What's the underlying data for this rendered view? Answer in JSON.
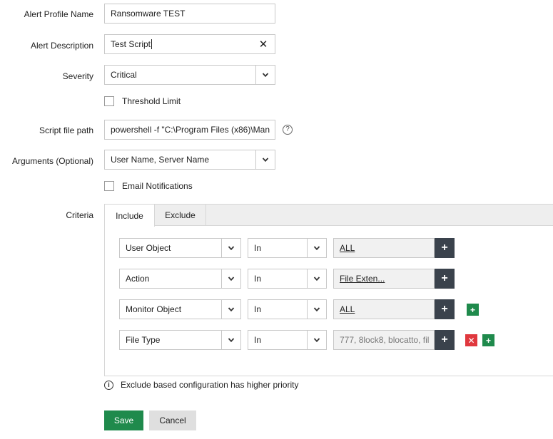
{
  "form": {
    "alert_profile_name": {
      "label": "Alert Profile Name",
      "value": "Ransomware TEST"
    },
    "alert_description": {
      "label": "Alert Description",
      "value": "Test Script"
    },
    "severity": {
      "label": "Severity",
      "value": "Critical"
    },
    "threshold_limit": {
      "label": "Threshold Limit",
      "checked": false
    },
    "script_file_path": {
      "label": "Script file path",
      "value": "powershell -f \"C:\\Program Files (x86)\\Man"
    },
    "arguments": {
      "label": "Arguments (Optional)",
      "value": "User Name, Server Name"
    },
    "email_notifications": {
      "label": "Email Notifications",
      "checked": false
    }
  },
  "criteria": {
    "label": "Criteria",
    "tabs": [
      {
        "label": "Include",
        "active": true
      },
      {
        "label": "Exclude",
        "active": false
      }
    ],
    "rows": [
      {
        "field": "User Object",
        "operator": "In",
        "value": "ALL"
      },
      {
        "field": "Action",
        "operator": "In",
        "value": "File Exten..."
      },
      {
        "field": "Monitor Object",
        "operator": "In",
        "value": "ALL"
      },
      {
        "field": "File Type",
        "operator": "In",
        "value": "777, 8lock8, blocatto, fil"
      }
    ]
  },
  "info_note": "Exclude based configuration has higher priority",
  "buttons": {
    "save": "Save",
    "cancel": "Cancel"
  },
  "icons": {
    "help": "?",
    "info": "i",
    "clear": "✕",
    "plus": "+",
    "remove": "✕"
  },
  "colors": {
    "primary": "#1f8a4c",
    "danger": "#e0383e",
    "dark_button": "#3a424c"
  }
}
